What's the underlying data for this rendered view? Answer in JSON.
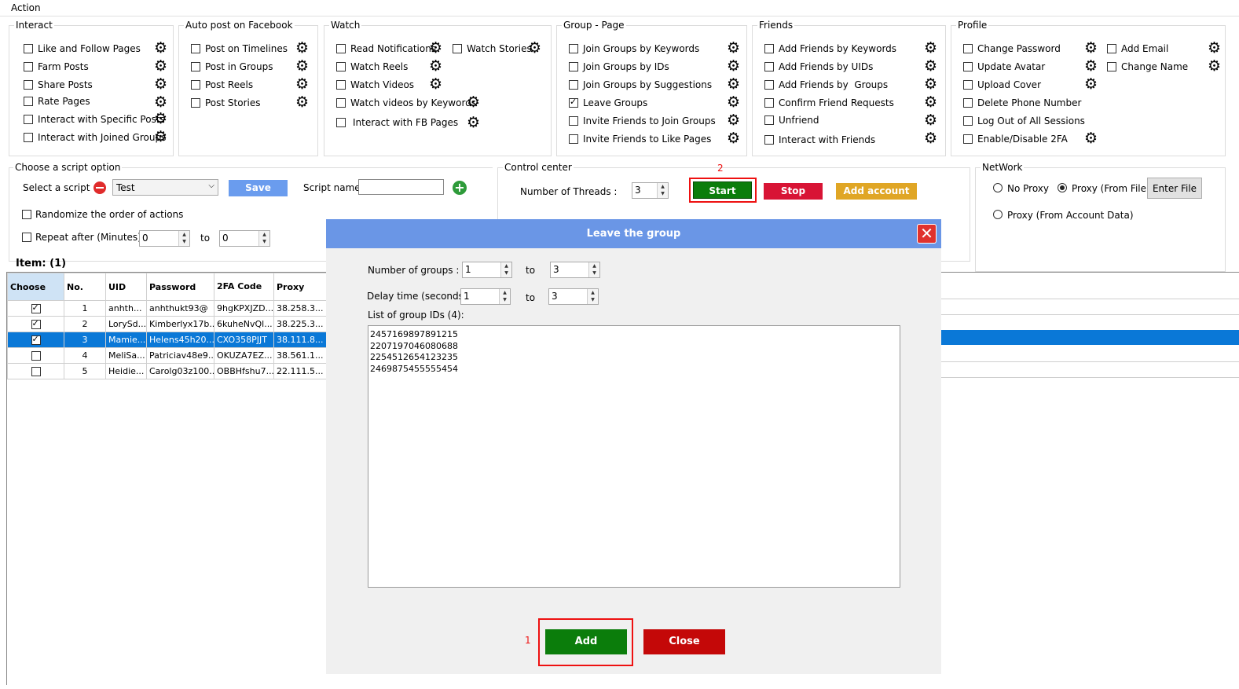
{
  "action_label": "Action",
  "groups": {
    "interact": {
      "title": "Interact",
      "items": [
        {
          "label": "Like and Follow Pages",
          "checked": false
        },
        {
          "label": "Farm Posts",
          "checked": false
        },
        {
          "label": "Share Posts",
          "checked": false
        },
        {
          "label": "Rate Pages",
          "checked": false
        },
        {
          "label": "Interact with Specific Posts",
          "checked": false
        },
        {
          "label": "Interact with Joined Groups",
          "checked": false
        }
      ]
    },
    "autopost": {
      "title": "Auto post on Facebook",
      "items": [
        {
          "label": "Post on Timelines",
          "checked": false
        },
        {
          "label": "Post in Groups",
          "checked": false
        },
        {
          "label": "Post Reels",
          "checked": false
        },
        {
          "label": "Post Stories",
          "checked": false
        }
      ]
    },
    "watch": {
      "title": "Watch",
      "items": [
        {
          "label": "Read Notifications",
          "checked": false
        },
        {
          "label": "Watch Stories",
          "checked": false
        },
        {
          "label": "Watch Reels",
          "checked": false
        },
        {
          "label": "Watch Videos",
          "checked": false
        },
        {
          "label": "Watch videos by Keywords",
          "checked": false
        },
        {
          "label": "Interact with FB Pages",
          "checked": false
        }
      ]
    },
    "grouppage": {
      "title": "Group - Page",
      "items": [
        {
          "label": "Join Groups by Keywords",
          "checked": false
        },
        {
          "label": "Join Groups by IDs",
          "checked": false
        },
        {
          "label": "Join Groups by Suggestions",
          "checked": false
        },
        {
          "label": "Leave Groups",
          "checked": true
        },
        {
          "label": "Invite Friends to Join Groups",
          "checked": false
        },
        {
          "label": "Invite Friends to Like Pages",
          "checked": false
        }
      ]
    },
    "friends": {
      "title": "Friends",
      "items": [
        {
          "label": "Add Friends by Keywords",
          "checked": false
        },
        {
          "label": "Add Friends by UIDs",
          "checked": false
        },
        {
          "label": "Add Friends by  Groups",
          "checked": false
        },
        {
          "label": "Confirm Friend Requests",
          "checked": false
        },
        {
          "label": "Unfriend",
          "checked": false
        },
        {
          "label": "Interact with Friends",
          "checked": false
        }
      ]
    },
    "profile": {
      "title": "Profile",
      "items": [
        {
          "label": "Change Password",
          "checked": false
        },
        {
          "label": "Update Avatar",
          "checked": false
        },
        {
          "label": "Upload Cover",
          "checked": false
        },
        {
          "label": "Delete Phone Number",
          "checked": false
        },
        {
          "label": "Log Out of All Sessions",
          "checked": false
        },
        {
          "label": "Enable/Disable 2FA",
          "checked": false
        },
        {
          "label": "Add Email",
          "checked": false
        },
        {
          "label": "Change Name",
          "checked": false
        }
      ]
    }
  },
  "script": {
    "title": "Choose a script option",
    "select_label": "Select a script",
    "selected": "Test",
    "save": "Save",
    "name_label": "Script name:",
    "name_value": "",
    "randomize": "Randomize the order of actions",
    "repeat": "Repeat after (Minutes)",
    "repeat_from": "0",
    "repeat_to": "0",
    "to": "to"
  },
  "control": {
    "title": "Control center",
    "threads_label": "Number of Threads :",
    "threads": "3",
    "start": "Start",
    "stop": "Stop",
    "add_account": "Add account",
    "marker": "2"
  },
  "network": {
    "title": "NetWork",
    "no_proxy": "No Proxy",
    "proxy_file": "Proxy (From File)",
    "enter_file": "Enter File",
    "proxy_account": "Proxy (From Account Data)"
  },
  "table": {
    "item_count": "Item: (1)",
    "headers": [
      "Choose",
      "No.",
      "UID",
      "Password",
      "2FA Code",
      "Proxy"
    ],
    "rows": [
      {
        "checked": true,
        "no": "1",
        "uid": "anhth...",
        "password": "anhthukt93@",
        "code": "9hgKPXJZD...",
        "proxy": "38.258.3..."
      },
      {
        "checked": true,
        "no": "2",
        "uid": "LorySd...",
        "password": "Kimberlyx17b...",
        "code": "6kuheNvQl...",
        "proxy": "38.225.3..."
      },
      {
        "checked": true,
        "no": "3",
        "uid": "Mamie...",
        "password": "Helens45h20...",
        "code": "CXO358PJJT",
        "proxy": "38.111.8..."
      },
      {
        "checked": false,
        "no": "4",
        "uid": "MeliSa...",
        "password": "Patriciav48e9...",
        "code": "OKUZA7EZ...",
        "proxy": "38.561.1..."
      },
      {
        "checked": false,
        "no": "5",
        "uid": "Heidie...",
        "password": "Carolg03z100...",
        "code": "OBBHfshu7...",
        "proxy": "22.111.5..."
      }
    ]
  },
  "dialog": {
    "title": "Leave the group",
    "groups_label": "Number of groups :",
    "groups_from": "1",
    "groups_to": "3",
    "delay_label": "Delay time (seconds):",
    "delay_from": "1",
    "delay_to": "3",
    "to": "to",
    "list_label": "List of group IDs (4):",
    "ids": [
      "2457169897891215",
      "2207197046080688",
      "2254512654123235",
      "2469875455555454"
    ],
    "add": "Add",
    "close": "Close",
    "marker": "1"
  },
  "colors": {
    "start": "#0b7d0b",
    "stop": "#d81435",
    "add_account": "#e0a625",
    "save": "#6a9cee",
    "dialog_header": "#6a96e6",
    "close": "#c40808",
    "selected_row": "#0a78d7"
  }
}
